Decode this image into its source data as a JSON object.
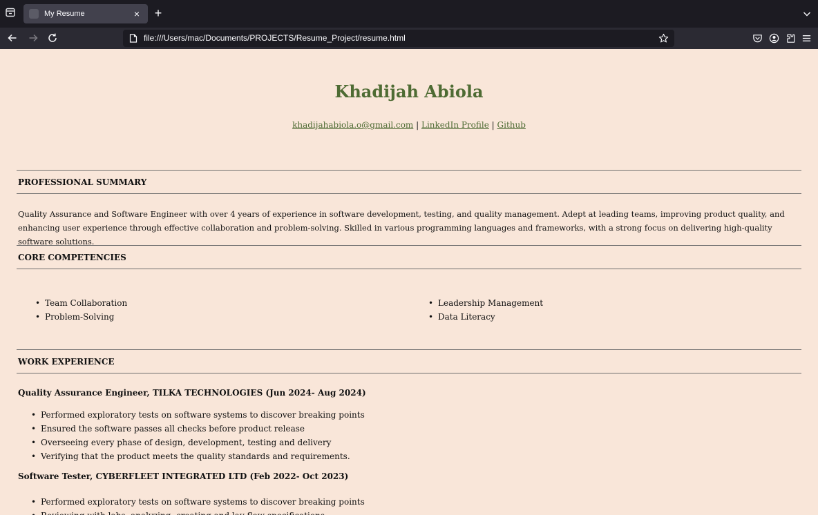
{
  "browser": {
    "tab_title": "My Resume",
    "tab_close": "×",
    "new_tab": "+",
    "url": "file:///Users/mac/Documents/PROJECTS/Resume_Project/resume.html"
  },
  "resume": {
    "name": "Khadijah Abiola",
    "contacts": {
      "email": "khadijahabiola.o@gmail.com",
      "separator": " | ",
      "linkedin": "LinkedIn Profile",
      "github": "Github"
    },
    "summary": {
      "title": "PROFESSIONAL SUMMARY",
      "text": "Quality Assurance and Software Engineer with over 4 years of experience in software development, testing, and quality management. Adept at leading teams, improving product quality, and enhancing user experience through effective collaboration and problem-solving. Skilled in various programming languages and frameworks, with a strong focus on delivering high-quality software solutions."
    },
    "competencies": {
      "title": "CORE COMPETENCIES",
      "left": [
        "Team Collaboration",
        "Problem-Solving"
      ],
      "right": [
        "Leadership Management",
        "Data Literacy"
      ]
    },
    "experience": {
      "title": "WORK EXPERIENCE",
      "jobs": [
        {
          "heading": "Quality Assurance Engineer, TILKA TECHNOLOGIES (Jun 2024- Aug 2024)",
          "bullets": [
            "Performed exploratory tests on software systems to discover breaking points",
            "Ensured the software passes all checks before product release",
            "Overseeing every phase of design, development, testing and delivery",
            "Verifying that the product meets the quality standards and requirements."
          ]
        },
        {
          "heading": "Software Tester, CYBERFLEET INTEGRATED LTD (Feb 2022- Oct 2023)",
          "bullets": [
            "Performed exploratory tests on software systems to discover breaking points",
            "Reviewing with labs, analyzing, creating and lay flow specifications"
          ]
        }
      ]
    }
  }
}
